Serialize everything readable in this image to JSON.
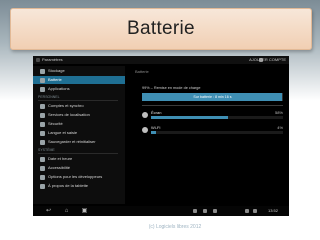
{
  "slide": {
    "title": "Batterie",
    "footer": "(c) Logiciels libres 2012"
  },
  "app": {
    "title": "Paramètres",
    "action_label": "AJOUTER COMPTE"
  },
  "sidebar": {
    "items": [
      {
        "label": "Stockage",
        "icon": "storage-icon",
        "selected": false
      },
      {
        "label": "Batterie",
        "icon": "battery-icon",
        "selected": true
      },
      {
        "label": "Applications",
        "icon": "apps-icon",
        "selected": false
      },
      {
        "header": "PERSONNEL"
      },
      {
        "label": "Comptes et synchro",
        "icon": "sync-icon",
        "selected": false
      },
      {
        "label": "Services de localisation",
        "icon": "location-icon",
        "selected": false
      },
      {
        "label": "Sécurité",
        "icon": "lock-icon",
        "selected": false
      },
      {
        "label": "Langue et saisie",
        "icon": "keyboard-icon",
        "selected": false
      },
      {
        "label": "Sauvegarder et réinitialiser",
        "icon": "backup-icon",
        "selected": false
      },
      {
        "header": "SYSTÈME"
      },
      {
        "label": "Date et heure",
        "icon": "clock-icon",
        "selected": false
      },
      {
        "label": "Accessibilité",
        "icon": "accessibility-icon",
        "selected": false
      },
      {
        "label": "Options pour les développeurs",
        "icon": "developer-icon",
        "selected": false
      },
      {
        "label": "À propos de la tablette",
        "icon": "info-icon",
        "selected": false
      }
    ]
  },
  "content": {
    "title": "Batterie",
    "status": "99% – Remise en mode de charge",
    "battery_level": 0.99,
    "time_label": "Sur batterie : 8 min 16 s",
    "usage": [
      {
        "name": "Écran",
        "percent": "58%",
        "fraction": 0.58,
        "icon": "screen-icon"
      },
      {
        "name": "Wi-Fi",
        "percent": "4%",
        "fraction": 0.04,
        "icon": "wifi-icon"
      }
    ]
  },
  "navbar": {
    "clock": "13:52",
    "buttons": [
      "back-icon",
      "home-icon",
      "recent-apps-icon"
    ]
  }
}
